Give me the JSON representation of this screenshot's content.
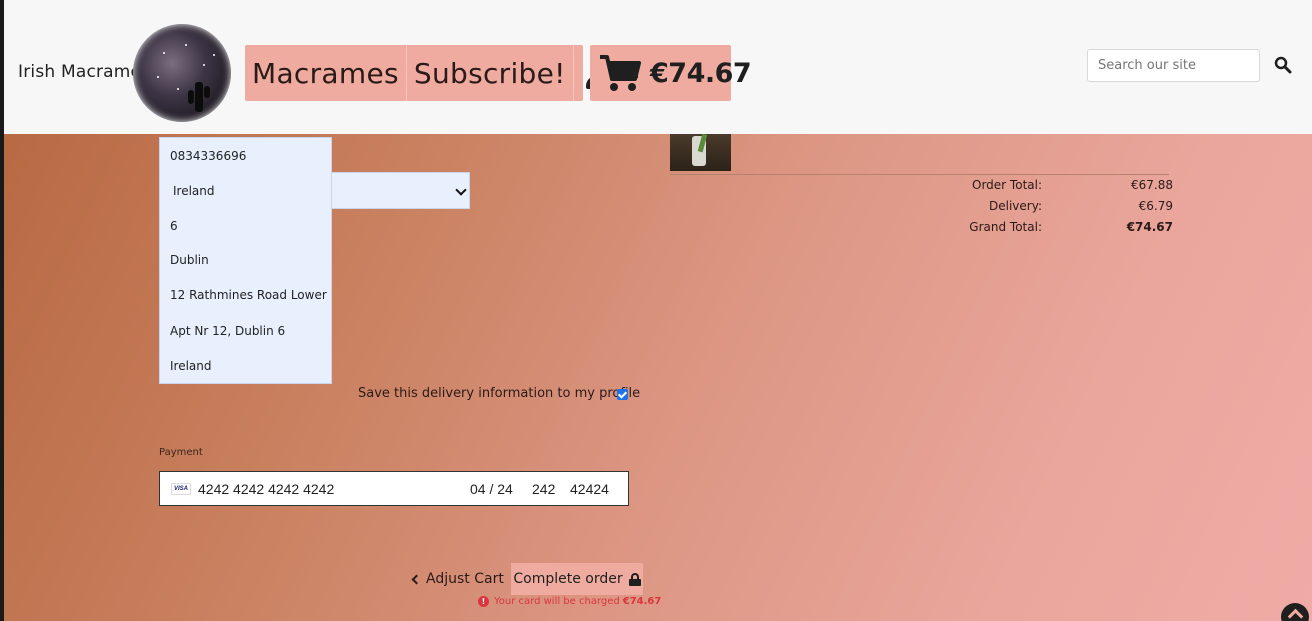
{
  "header": {
    "brand": "Irish Macrames",
    "nav": {
      "macrames": "Macrames",
      "subscribe": "Subscribe!"
    },
    "cart_total": "€74.67",
    "search": {
      "placeholder": "Search our site"
    }
  },
  "delivery_form": {
    "autocomplete_options": [
      "0834336696",
      "Ireland",
      "6",
      "Dublin",
      "12 Rathmines Road Lower",
      "Apt Nr 12, Dublin 6",
      "Ireland"
    ],
    "save_info_label": "Save this delivery information to my profile",
    "save_info_checked": true
  },
  "payment": {
    "label": "Payment",
    "card_brand": "VISA",
    "card_number": "4242 4242 4242 4242",
    "expiry": "04 / 24",
    "cvc": "242",
    "postal": "42424"
  },
  "actions": {
    "adjust_cart": "Adjust Cart",
    "complete_order": "Complete order",
    "charge_note": "Your card will be charged",
    "charge_amount": "€74.67"
  },
  "order_summary": {
    "rows": [
      {
        "label": "Order Total:",
        "value": "€67.88"
      },
      {
        "label": "Delivery:",
        "value": "€6.79"
      },
      {
        "label": "Grand Total:",
        "value": "€74.67"
      }
    ]
  },
  "colors": {
    "accent": "#f0aba0",
    "alert": "#d9363e",
    "autofill": "#e8f0fe"
  }
}
